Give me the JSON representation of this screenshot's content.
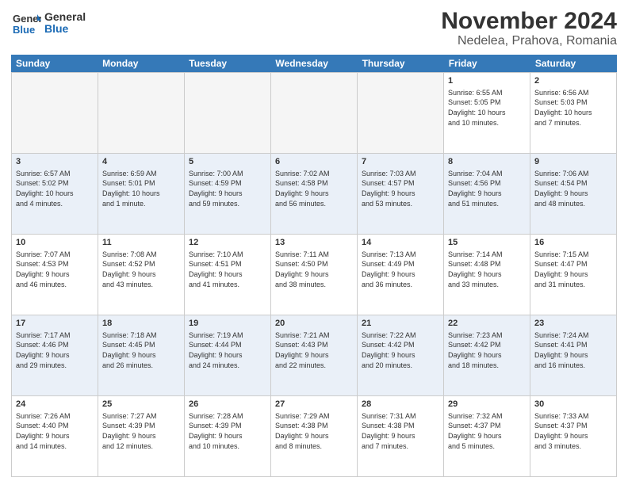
{
  "logo": {
    "general": "General",
    "blue": "Blue"
  },
  "title": "November 2024",
  "subtitle": "Nedelea, Prahova, Romania",
  "headers": [
    "Sunday",
    "Monday",
    "Tuesday",
    "Wednesday",
    "Thursday",
    "Friday",
    "Saturday"
  ],
  "rows": [
    [
      {
        "num": "",
        "info": "",
        "empty": true
      },
      {
        "num": "",
        "info": "",
        "empty": true
      },
      {
        "num": "",
        "info": "",
        "empty": true
      },
      {
        "num": "",
        "info": "",
        "empty": true
      },
      {
        "num": "",
        "info": "",
        "empty": true
      },
      {
        "num": "1",
        "info": "Sunrise: 6:55 AM\nSunset: 5:05 PM\nDaylight: 10 hours\nand 10 minutes.",
        "empty": false
      },
      {
        "num": "2",
        "info": "Sunrise: 6:56 AM\nSunset: 5:03 PM\nDaylight: 10 hours\nand 7 minutes.",
        "empty": false
      }
    ],
    [
      {
        "num": "3",
        "info": "Sunrise: 6:57 AM\nSunset: 5:02 PM\nDaylight: 10 hours\nand 4 minutes.",
        "empty": false
      },
      {
        "num": "4",
        "info": "Sunrise: 6:59 AM\nSunset: 5:01 PM\nDaylight: 10 hours\nand 1 minute.",
        "empty": false
      },
      {
        "num": "5",
        "info": "Sunrise: 7:00 AM\nSunset: 4:59 PM\nDaylight: 9 hours\nand 59 minutes.",
        "empty": false
      },
      {
        "num": "6",
        "info": "Sunrise: 7:02 AM\nSunset: 4:58 PM\nDaylight: 9 hours\nand 56 minutes.",
        "empty": false
      },
      {
        "num": "7",
        "info": "Sunrise: 7:03 AM\nSunset: 4:57 PM\nDaylight: 9 hours\nand 53 minutes.",
        "empty": false
      },
      {
        "num": "8",
        "info": "Sunrise: 7:04 AM\nSunset: 4:56 PM\nDaylight: 9 hours\nand 51 minutes.",
        "empty": false
      },
      {
        "num": "9",
        "info": "Sunrise: 7:06 AM\nSunset: 4:54 PM\nDaylight: 9 hours\nand 48 minutes.",
        "empty": false
      }
    ],
    [
      {
        "num": "10",
        "info": "Sunrise: 7:07 AM\nSunset: 4:53 PM\nDaylight: 9 hours\nand 46 minutes.",
        "empty": false
      },
      {
        "num": "11",
        "info": "Sunrise: 7:08 AM\nSunset: 4:52 PM\nDaylight: 9 hours\nand 43 minutes.",
        "empty": false
      },
      {
        "num": "12",
        "info": "Sunrise: 7:10 AM\nSunset: 4:51 PM\nDaylight: 9 hours\nand 41 minutes.",
        "empty": false
      },
      {
        "num": "13",
        "info": "Sunrise: 7:11 AM\nSunset: 4:50 PM\nDaylight: 9 hours\nand 38 minutes.",
        "empty": false
      },
      {
        "num": "14",
        "info": "Sunrise: 7:13 AM\nSunset: 4:49 PM\nDaylight: 9 hours\nand 36 minutes.",
        "empty": false
      },
      {
        "num": "15",
        "info": "Sunrise: 7:14 AM\nSunset: 4:48 PM\nDaylight: 9 hours\nand 33 minutes.",
        "empty": false
      },
      {
        "num": "16",
        "info": "Sunrise: 7:15 AM\nSunset: 4:47 PM\nDaylight: 9 hours\nand 31 minutes.",
        "empty": false
      }
    ],
    [
      {
        "num": "17",
        "info": "Sunrise: 7:17 AM\nSunset: 4:46 PM\nDaylight: 9 hours\nand 29 minutes.",
        "empty": false
      },
      {
        "num": "18",
        "info": "Sunrise: 7:18 AM\nSunset: 4:45 PM\nDaylight: 9 hours\nand 26 minutes.",
        "empty": false
      },
      {
        "num": "19",
        "info": "Sunrise: 7:19 AM\nSunset: 4:44 PM\nDaylight: 9 hours\nand 24 minutes.",
        "empty": false
      },
      {
        "num": "20",
        "info": "Sunrise: 7:21 AM\nSunset: 4:43 PM\nDaylight: 9 hours\nand 22 minutes.",
        "empty": false
      },
      {
        "num": "21",
        "info": "Sunrise: 7:22 AM\nSunset: 4:42 PM\nDaylight: 9 hours\nand 20 minutes.",
        "empty": false
      },
      {
        "num": "22",
        "info": "Sunrise: 7:23 AM\nSunset: 4:42 PM\nDaylight: 9 hours\nand 18 minutes.",
        "empty": false
      },
      {
        "num": "23",
        "info": "Sunrise: 7:24 AM\nSunset: 4:41 PM\nDaylight: 9 hours\nand 16 minutes.",
        "empty": false
      }
    ],
    [
      {
        "num": "24",
        "info": "Sunrise: 7:26 AM\nSunset: 4:40 PM\nDaylight: 9 hours\nand 14 minutes.",
        "empty": false
      },
      {
        "num": "25",
        "info": "Sunrise: 7:27 AM\nSunset: 4:39 PM\nDaylight: 9 hours\nand 12 minutes.",
        "empty": false
      },
      {
        "num": "26",
        "info": "Sunrise: 7:28 AM\nSunset: 4:39 PM\nDaylight: 9 hours\nand 10 minutes.",
        "empty": false
      },
      {
        "num": "27",
        "info": "Sunrise: 7:29 AM\nSunset: 4:38 PM\nDaylight: 9 hours\nand 8 minutes.",
        "empty": false
      },
      {
        "num": "28",
        "info": "Sunrise: 7:31 AM\nSunset: 4:38 PM\nDaylight: 9 hours\nand 7 minutes.",
        "empty": false
      },
      {
        "num": "29",
        "info": "Sunrise: 7:32 AM\nSunset: 4:37 PM\nDaylight: 9 hours\nand 5 minutes.",
        "empty": false
      },
      {
        "num": "30",
        "info": "Sunrise: 7:33 AM\nSunset: 4:37 PM\nDaylight: 9 hours\nand 3 minutes.",
        "empty": false
      }
    ]
  ]
}
